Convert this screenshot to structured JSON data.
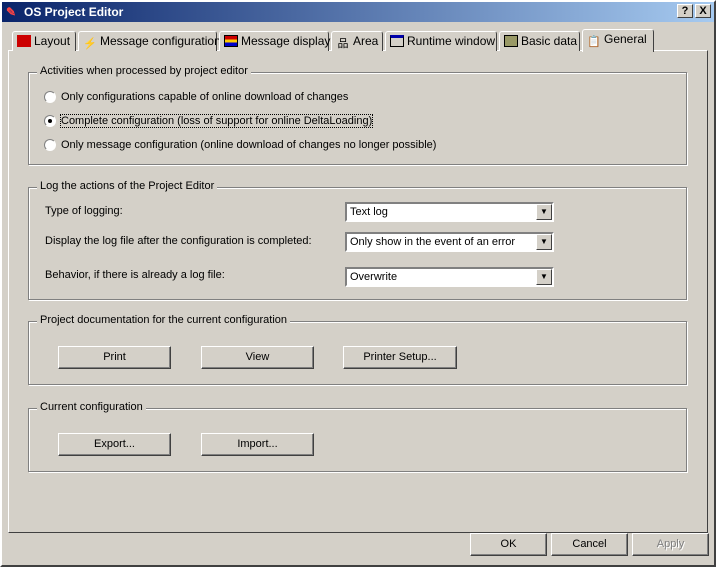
{
  "window": {
    "title": "OS Project Editor",
    "help": "?",
    "close": "X"
  },
  "tabs": [
    {
      "label": "Layout",
      "icon": "layout-icon"
    },
    {
      "label": "Message configuration",
      "icon": "message-configuration-icon"
    },
    {
      "label": "Message display",
      "icon": "message-display-icon"
    },
    {
      "label": "Area",
      "icon": "area-hierarchy-icon"
    },
    {
      "label": "Runtime window",
      "icon": "runtime-window-icon"
    },
    {
      "label": "Basic data",
      "icon": "basic-data-icon"
    },
    {
      "label": "General",
      "icon": "general-icon",
      "selected": true
    }
  ],
  "activities": {
    "title": "Activities when processed by project editor",
    "options": [
      {
        "label": "Only configurations capable of online download of changes",
        "checked": false
      },
      {
        "label": "Complete configuration (loss of support for online DeltaLoading)",
        "checked": true
      },
      {
        "label": "Only message configuration (online download of changes no longer possible)",
        "checked": false
      }
    ]
  },
  "logging": {
    "title": "Log the actions of the Project Editor",
    "type_label": "Type of logging:",
    "type_value": "Text log",
    "display_label": "Display the log file after the configuration is completed:",
    "display_value": "Only show in the event of an error",
    "behavior_label": "Behavior, if there is already a log file:",
    "behavior_value": "Overwrite"
  },
  "documentation": {
    "title": "Project documentation for the current configuration",
    "print": "Print",
    "view": "View",
    "printer_setup": "Printer Setup..."
  },
  "current": {
    "title": "Current configuration",
    "export": "Export...",
    "import": "Import..."
  },
  "footer": {
    "ok": "OK",
    "cancel": "Cancel",
    "apply": "Apply"
  }
}
